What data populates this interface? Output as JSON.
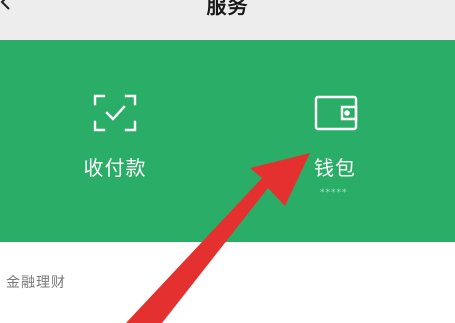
{
  "header": {
    "title": "服务",
    "back_icon": "chevron-left-icon",
    "more_icon": "more-icon"
  },
  "services": [
    {
      "label": "收付款",
      "icon": "scan-pay-icon"
    },
    {
      "label": "钱包",
      "icon": "wallet-icon",
      "balance_masked": "*****"
    }
  ],
  "sections": [
    {
      "title": "金融理财"
    }
  ],
  "annotation": {
    "icon": "red-arrow-annotation",
    "color": "#e53030"
  },
  "colors": {
    "panel_green": "#2aae67",
    "background": "#efefef"
  }
}
